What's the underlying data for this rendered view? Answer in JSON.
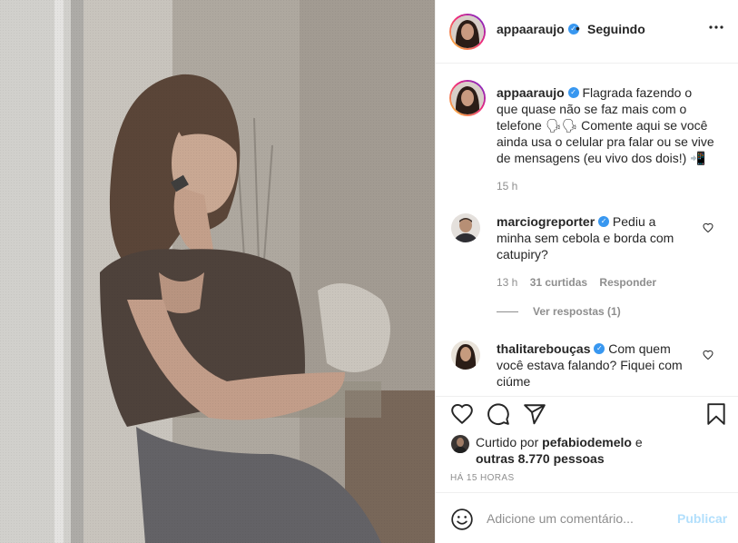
{
  "post": {
    "author": "appaaraujo",
    "follow_separator": "•",
    "follow_status": "Seguindo",
    "more_glyph": "•••",
    "verified_glyph": "✓"
  },
  "caption": {
    "username": "appaaraujo",
    "text": " Flagrada fazendo o que quase não se faz mais com o telefone 🗣🗣 Comente aqui se você ainda usa o celular pra falar ou se vive de mensagens (eu vivo dos dois!) 📲",
    "time": "15 h"
  },
  "comments": [
    {
      "username": "marciogreporter",
      "text": " Pediu a minha sem cebola e borda com catupiry?",
      "time": "13 h",
      "likes": "31 curtidas",
      "reply": "Responder",
      "view_replies": "Ver respostas (1)"
    },
    {
      "username": "thalitarebouças",
      "text": " Com quem você estava falando? Fiquei com ciúme"
    }
  ],
  "likes": {
    "prefix": "Curtido por ",
    "user": "pefabiodemelo",
    "middle": " e ",
    "others": "outras 8.770 pessoas"
  },
  "post_time": "HÁ 15 HORAS",
  "add_comment": {
    "placeholder": "Adicione um comentário...",
    "publish": "Publicar"
  },
  "icons": {
    "like": "heart-icon",
    "comment": "comment-icon",
    "share": "share-icon",
    "save": "bookmark-icon",
    "emoji": "emoji-icon",
    "more": "more-icon",
    "verified": "verified-badge-icon"
  },
  "colors": {
    "verified": "#3897f0",
    "publish_disabled": "#b2dffc",
    "meta_text": "#8e8e8e"
  }
}
